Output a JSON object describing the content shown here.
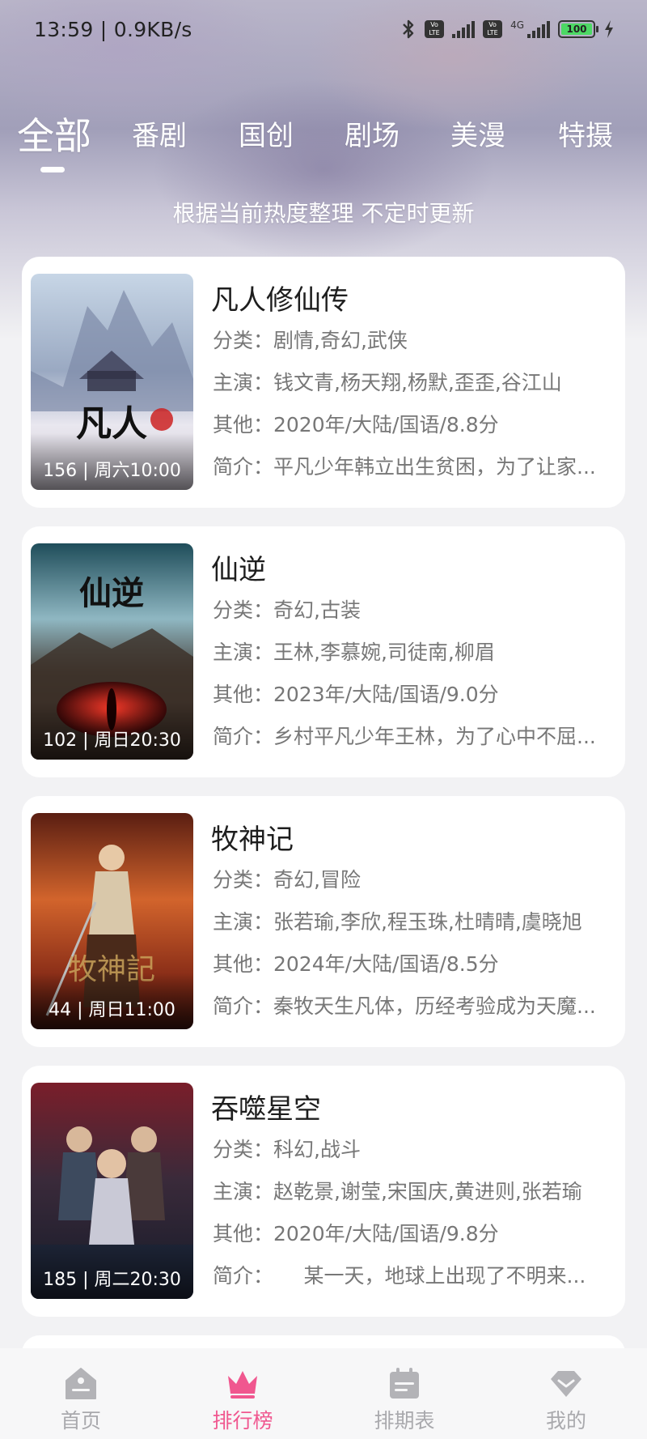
{
  "status_bar": {
    "time": "13:59 | 0.9KB/s",
    "volte": "Vo LTE",
    "network": "4G",
    "battery": "100",
    "icons": [
      "bluetooth-icon",
      "volte-icon",
      "signal-icon",
      "signal-icon",
      "battery-icon",
      "charging-icon"
    ]
  },
  "tabs": [
    {
      "label": "全部",
      "active": true
    },
    {
      "label": "番剧",
      "active": false
    },
    {
      "label": "国创",
      "active": false
    },
    {
      "label": "剧场",
      "active": false
    },
    {
      "label": "美漫",
      "active": false
    },
    {
      "label": "特摄",
      "active": false
    }
  ],
  "subtitle": "根据当前热度整理 不定时更新",
  "items": [
    {
      "title": "凡人修仙传",
      "badge": "156 | 周六10:00",
      "category": "分类：剧情,奇幻,武侠",
      "cast": "主演：钱文青,杨天翔,杨默,歪歪,谷江山",
      "other": "其他：2020年/大陆/国语/8.8分",
      "summary": "简介：平凡少年韩立出生贫困，为了让家..."
    },
    {
      "title": "仙逆",
      "badge": "102 | 周日20:30",
      "category": "分类：奇幻,古装",
      "cast": "主演：王林,李慕婉,司徒南,柳眉",
      "other": "其他：2023年/大陆/国语/9.0分",
      "summary": "简介：乡村平凡少年王林，为了心中不屈..."
    },
    {
      "title": "牧神记",
      "badge": "44 | 周日11:00",
      "category": "分类：奇幻,冒险",
      "cast": "主演：张若瑜,李欣,程玉珠,杜晴晴,虞晓旭",
      "other": "其他：2024年/大陆/国语/8.5分",
      "summary": "简介：秦牧天生凡体，历经考验成为天魔..."
    },
    {
      "title": "吞噬星空",
      "badge": "185 | 周二20:30",
      "category": "分类：科幻,战斗",
      "cast": "主演：赵乾景,谢莹,宋国庆,黄进则,张若瑜",
      "other": "其他：2020年/大陆/国语/9.8分",
      "summary": "简介：　　某一天，地球上出现了不明来..."
    }
  ],
  "tabbar": [
    {
      "label": "首页",
      "icon": "home-icon",
      "active": false
    },
    {
      "label": "排行榜",
      "icon": "crown-icon",
      "active": true
    },
    {
      "label": "排期表",
      "icon": "calendar-icon",
      "active": false
    },
    {
      "label": "我的",
      "icon": "profile-icon",
      "active": false
    }
  ],
  "colors": {
    "accent": "#f0578f",
    "inactive": "#a9a9ad"
  }
}
